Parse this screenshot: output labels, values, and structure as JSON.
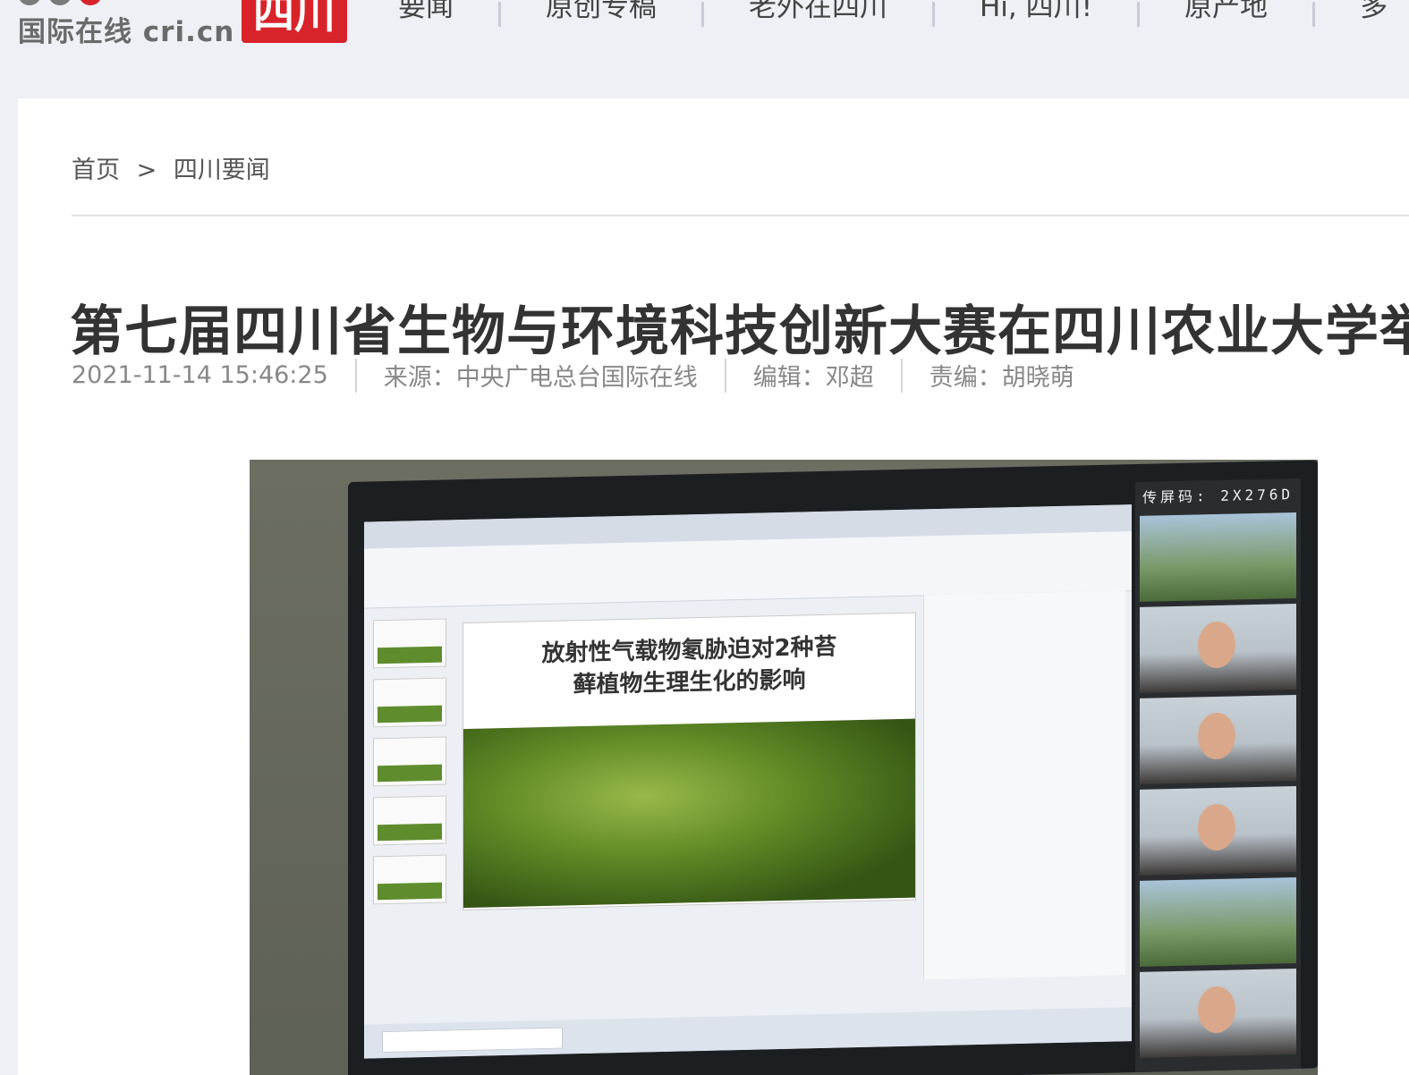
{
  "header": {
    "logo_text": "国际在线 cri.cn",
    "logo_badge": "四川",
    "nav": [
      "要闻",
      "原创专稿",
      "老外在四川",
      "Hi, 四川!",
      "原产地",
      "多"
    ]
  },
  "breadcrumb": {
    "home": "首页",
    "separator": ">",
    "section": "四川要闻"
  },
  "article": {
    "title": "第七届四川省生物与环境科技创新大赛在四川农业大学举",
    "datetime": "2021-11-14 15:46:25",
    "source": "来源：中央广电总台国际在线",
    "editor": "编辑：邓超",
    "responsible_editor": "责编：胡晓萌"
  },
  "photo": {
    "slide_title_line1": "放射性气载物氡胁迫对2种苔",
    "slide_title_line2": "藓植物生理生化的影响",
    "meeting_code": "传屏码: 2X276D"
  },
  "colors": {
    "brand_red": "#d9232a",
    "page_bg": "#eef0f6",
    "card_bg": "#ffffff"
  }
}
